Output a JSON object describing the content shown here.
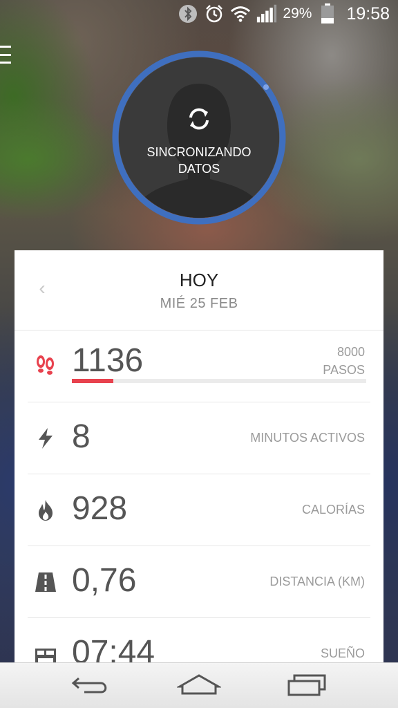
{
  "status_bar": {
    "icons": [
      "bluetooth-icon",
      "alarm-icon",
      "wifi-icon",
      "signal-icon",
      "battery-icon"
    ],
    "battery_percent": "29%",
    "time": "19:58"
  },
  "sync": {
    "line1": "SINCRONIZANDO",
    "line2": "DATOS",
    "ring_color": "#3f6fbf"
  },
  "card": {
    "back_symbol": "‹",
    "title": "HOY",
    "date": "MIÉ 25 FEB"
  },
  "stats": {
    "steps": {
      "value": "1136",
      "goal": "8000",
      "unit": "PASOS",
      "progress_fraction": 0.142,
      "color": "#e8424e"
    },
    "active": {
      "value": "8",
      "label": "MINUTOS ACTIVOS"
    },
    "calories": {
      "value": "928",
      "label": "CALORÍAS"
    },
    "distance": {
      "value": "0,76",
      "label": "DISTANCIA (KM)"
    },
    "sleep": {
      "value": "07:44",
      "label": "SUEÑO"
    }
  },
  "nav": {
    "icons": [
      "back-icon",
      "home-icon",
      "recents-icon"
    ]
  }
}
